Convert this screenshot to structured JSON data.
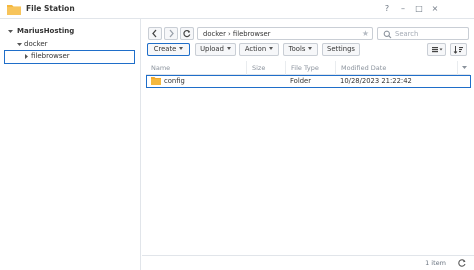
{
  "window": {
    "title": "File Station",
    "help_glyph": "?",
    "minimize_glyph": "–",
    "maximize_glyph": "□",
    "close_glyph": "×"
  },
  "sidebar": {
    "server": "MariusHosting",
    "items": [
      {
        "label": "docker",
        "expanded": true
      },
      {
        "label": "filebrowser",
        "selected": true
      }
    ]
  },
  "toolbar": {
    "path": "docker › filebrowser",
    "search_placeholder": "Search",
    "buttons": {
      "create": "Create",
      "upload": "Upload",
      "action": "Action",
      "tools": "Tools",
      "settings": "Settings"
    }
  },
  "table": {
    "columns": [
      "Name",
      "Size",
      "File Type",
      "Modified Date"
    ],
    "rows": [
      {
        "name": "config",
        "size": "",
        "type": "Folder",
        "modified": "10/28/2023 21:22:42"
      }
    ]
  },
  "footer": {
    "item_count": "1 item"
  },
  "colors": {
    "accent": "#1f6ec9",
    "folder": "#f5b83d"
  }
}
